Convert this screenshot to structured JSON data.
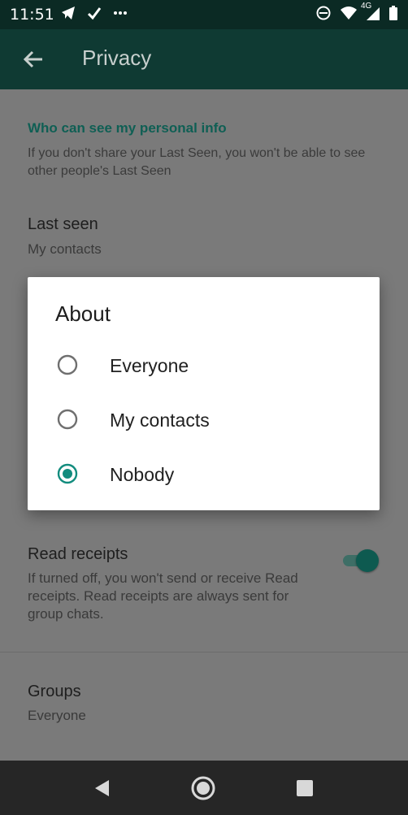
{
  "status_bar": {
    "time": "11:51",
    "network_label": "4G",
    "left_icons": [
      "telegram-icon",
      "check-icon",
      "more-dots-icon"
    ],
    "right_icons": [
      "do-not-disturb-icon",
      "wifi-icon",
      "signal-icon",
      "battery-icon"
    ]
  },
  "app_bar": {
    "title": "Privacy",
    "back_icon": "arrow-left-icon"
  },
  "privacy": {
    "section_title": "Who can see my personal info",
    "section_description": "If you don't share your Last Seen, you won't be able to see other people's Last Seen",
    "last_seen": {
      "title": "Last seen",
      "value": "My contacts"
    },
    "read_receipts": {
      "title": "Read receipts",
      "description": "If turned off, you won't send or receive Read receipts. Read receipts are always sent for group chats.",
      "enabled": true
    },
    "groups": {
      "title": "Groups",
      "value": "Everyone"
    }
  },
  "dialog": {
    "title": "About",
    "options": [
      {
        "label": "Everyone",
        "selected": false
      },
      {
        "label": "My contacts",
        "selected": false
      },
      {
        "label": "Nobody",
        "selected": true
      }
    ]
  },
  "nav_bar": {
    "icons": [
      "back-triangle-icon",
      "home-circle-icon",
      "recents-square-icon"
    ]
  },
  "colors": {
    "accent": "#0e5a50",
    "radio_selected": "#128c7e",
    "app_bar": "#0f3a33",
    "status_bar": "#0b2a24",
    "scrim": "#7a7a7a"
  }
}
